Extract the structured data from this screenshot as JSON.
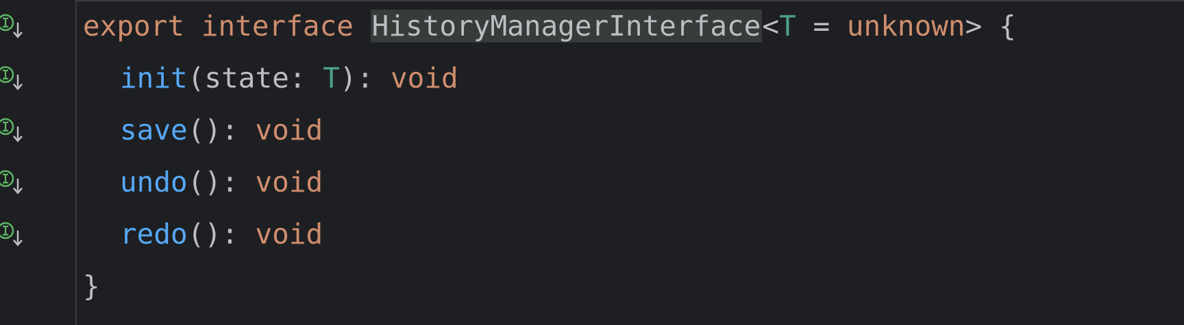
{
  "editor": {
    "lines": [
      {
        "tokens": [
          {
            "text": "export",
            "kind": "keyword"
          },
          {
            "text": " ",
            "kind": "plain"
          },
          {
            "text": "interface",
            "kind": "keyword"
          },
          {
            "text": " ",
            "kind": "plain"
          },
          {
            "text": "HistoryManagerInterface",
            "kind": "highlight"
          },
          {
            "text": "<",
            "kind": "plain"
          },
          {
            "text": "T",
            "kind": "type-param"
          },
          {
            "text": " = ",
            "kind": "plain"
          },
          {
            "text": "unknown",
            "kind": "keyword"
          },
          {
            "text": "> {",
            "kind": "plain"
          }
        ]
      },
      {
        "tokens": [
          {
            "text": "init",
            "kind": "function"
          },
          {
            "text": "(state: ",
            "kind": "plain"
          },
          {
            "text": "T",
            "kind": "type-param"
          },
          {
            "text": "): ",
            "kind": "plain"
          },
          {
            "text": "void",
            "kind": "keyword"
          }
        ]
      },
      {
        "tokens": [
          {
            "text": "save",
            "kind": "function"
          },
          {
            "text": "(): ",
            "kind": "plain"
          },
          {
            "text": "void",
            "kind": "keyword"
          }
        ]
      },
      {
        "tokens": [
          {
            "text": "undo",
            "kind": "function"
          },
          {
            "text": "(): ",
            "kind": "plain"
          },
          {
            "text": "void",
            "kind": "keyword"
          }
        ]
      },
      {
        "tokens": [
          {
            "text": "redo",
            "kind": "function"
          },
          {
            "text": "(): ",
            "kind": "plain"
          },
          {
            "text": "void",
            "kind": "keyword"
          }
        ]
      },
      {
        "tokens": [
          {
            "text": "}",
            "kind": "plain"
          }
        ]
      }
    ]
  },
  "gutter": {
    "marker_icon": "implemented-down-arrow-icon",
    "marker_color": "#5fb865"
  },
  "colors": {
    "background": "#1e1f22",
    "keyword": "#cf8e6d",
    "function": "#56a8f5",
    "type_param": "#4d9f8d",
    "plain": "#bcbec4",
    "highlight_bg": "#373b39"
  }
}
